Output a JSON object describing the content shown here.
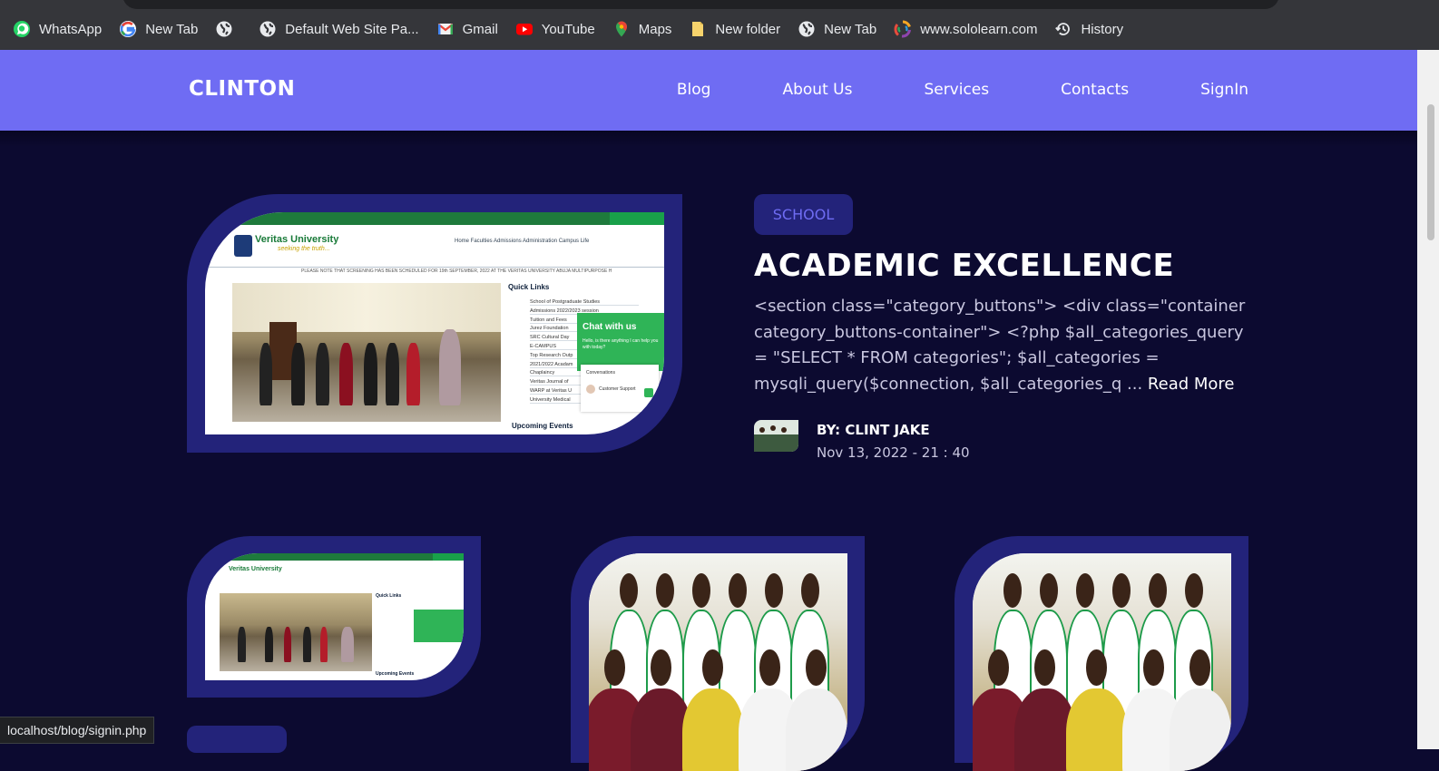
{
  "browser": {
    "bookmarks": [
      {
        "label": "WhatsApp",
        "icon": "whatsapp-icon"
      },
      {
        "label": "New Tab",
        "icon": "google-icon"
      },
      {
        "label": "",
        "icon": "globe-icon"
      },
      {
        "label": "Default Web Site Pa...",
        "icon": "globe-icon"
      },
      {
        "label": "Gmail",
        "icon": "gmail-icon"
      },
      {
        "label": "YouTube",
        "icon": "youtube-icon"
      },
      {
        "label": "Maps",
        "icon": "maps-icon"
      },
      {
        "label": "New folder",
        "icon": "folder-icon"
      },
      {
        "label": "New Tab",
        "icon": "globe-icon"
      },
      {
        "label": "www.sololearn.com",
        "icon": "sololearn-icon"
      },
      {
        "label": "History",
        "icon": "history-icon"
      }
    ],
    "status_url": "localhost/blog/signin.php"
  },
  "nav": {
    "brand": "CLINTON",
    "links": [
      "Blog",
      "About Us",
      "Services",
      "Contacts",
      "SignIn"
    ]
  },
  "featured": {
    "category": "SCHOOL",
    "title": "ACADEMIC EXCELLENCE",
    "body": "<section class=\"category_buttons\"> <div class=\"container category_buttons-container\"> <?php $all_categories_query = \"SELECT * FROM categories\"; $all_categories = mysqli_query($connection, $all_categories_q ... ",
    "read_more": "Read More",
    "author": "BY: CLINT JAKE",
    "date": "Nov 13, 2022 - 21 : 40"
  },
  "thumbnail_site": {
    "logo": "Veritas University",
    "tagline": "seeking the truth...",
    "menu": "Home   Faculties   Admissions   Administration   Campus Life",
    "notice": "PLEASE NOTE THAT SCREENING HAS BEEN SCHEDULED FOR 19th SEPTEMBER, 2022 AT THE VERITAS UNIVERSITY ABUJA MULTIPURPOSE H",
    "quick_links_title": "Quick Links",
    "quick_links": [
      "School of Postgraduate Studies",
      "Admissions 2022/2023 session",
      "Tuition and Fees",
      "Jurez Foundation",
      "SRC Cultural Day",
      "E-CAMPUS",
      "Top Research Outp",
      "2021/2022 Acadam",
      "Chaplaincy",
      "Veritas Journal of",
      "WARP at Veritas U",
      "University Medical"
    ],
    "upcoming": "Upcoming Events",
    "chat_title": "Chat with us",
    "chat_sub": "Hello, is there anything I can help you with today?",
    "chat_conv": "Conversations",
    "chat_support": "Customer Support"
  },
  "colors": {
    "page_bg": "#0c0a30",
    "navbar": "#6f6cf3",
    "frame": "#23237a",
    "accent": "#6f6cf3"
  }
}
